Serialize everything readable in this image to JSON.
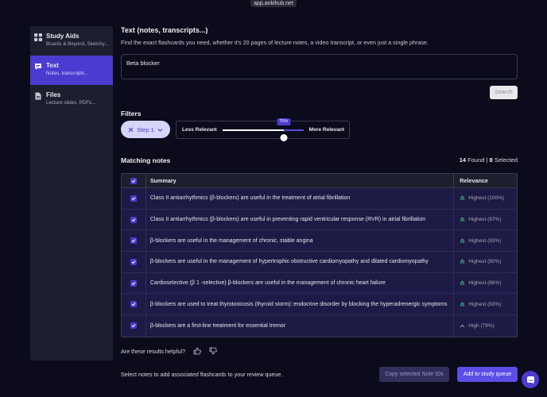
{
  "browser": {
    "url": "app.ankihub.net"
  },
  "sidebar": {
    "items": [
      {
        "title": "Study Aids",
        "subtitle": "Boards & Beyond, Sketchy...",
        "icon": "grid-icon",
        "active": false
      },
      {
        "title": "Text",
        "subtitle": "Notes, transcripts...",
        "icon": "chat-bubble-icon",
        "active": true
      },
      {
        "title": "Files",
        "subtitle": "Lecture slides, PDFs...",
        "icon": "document-icon",
        "active": false
      }
    ]
  },
  "main": {
    "title": "Text (notes, transcripts...)",
    "description": "Find the exact flashcards you need, whether it's 20 pages of lecture notes, a video transcript, or even just a single phrase.",
    "query_value": "Beta blocker",
    "search_label": "Search"
  },
  "filters": {
    "title": "Filters",
    "step_label": "Step 1",
    "less_label": "Less Relevant",
    "more_label": "More Relevant",
    "relevance_percent": 75,
    "relevance_text": "75%"
  },
  "results": {
    "title": "Matching notes",
    "found_count": "14",
    "found_label": "Found |",
    "selected_count": "8",
    "selected_label": "Selected",
    "col_summary": "Summary",
    "col_relevance": "Relevance",
    "rows": [
      {
        "summary": "Class II antiarrhythmics (β-blockers) are useful in the treatment of atrial fibrillation",
        "relevance": "Highest (100%)",
        "level": "highest",
        "checked": true
      },
      {
        "summary": "Class II antiarrhythmics (β-blockers) are useful in preventing rapid ventricular response (RVR) in atrial fibrillation",
        "relevance": "Highest (97%)",
        "level": "highest",
        "checked": true
      },
      {
        "summary": "β-blockers are useful in the management of chronic, stable angina",
        "relevance": "Highest (93%)",
        "level": "highest",
        "checked": true
      },
      {
        "summary": "β-blockers are useful in the management of hypertrophic obstructive cardiomyopathy and dilated cardiomyopathy",
        "relevance": "Highest (90%)",
        "level": "highest",
        "checked": true
      },
      {
        "summary": "Cardioselective (β 1 -selective) β-blockers are useful in the management of chronic heart failure",
        "relevance": "Highest (86%)",
        "level": "highest",
        "checked": true
      },
      {
        "summary": "β-blockers are used to treat thyrotoxicosis (thyroid storm)::endocrine disorder by blocking the hyperadrenergic symptoms",
        "relevance": "Highest (83%)",
        "level": "highest",
        "checked": true
      },
      {
        "summary": "β-blockers are a first-line treatment for essential tremor",
        "relevance": "High (79%)",
        "level": "high",
        "checked": true
      }
    ]
  },
  "feedback": {
    "question": "Are these results helpful?"
  },
  "footer": {
    "hint": "Select notes to add associated flashcards to your review queue.",
    "copy_label": "Copy selected Note IDs",
    "add_label": "Add to study queue"
  },
  "colors": {
    "accent": "#4b3bd0",
    "background": "#0b0b1b",
    "row_bg": "#1d1a45",
    "relevance_icon": "#3fbf7f"
  }
}
